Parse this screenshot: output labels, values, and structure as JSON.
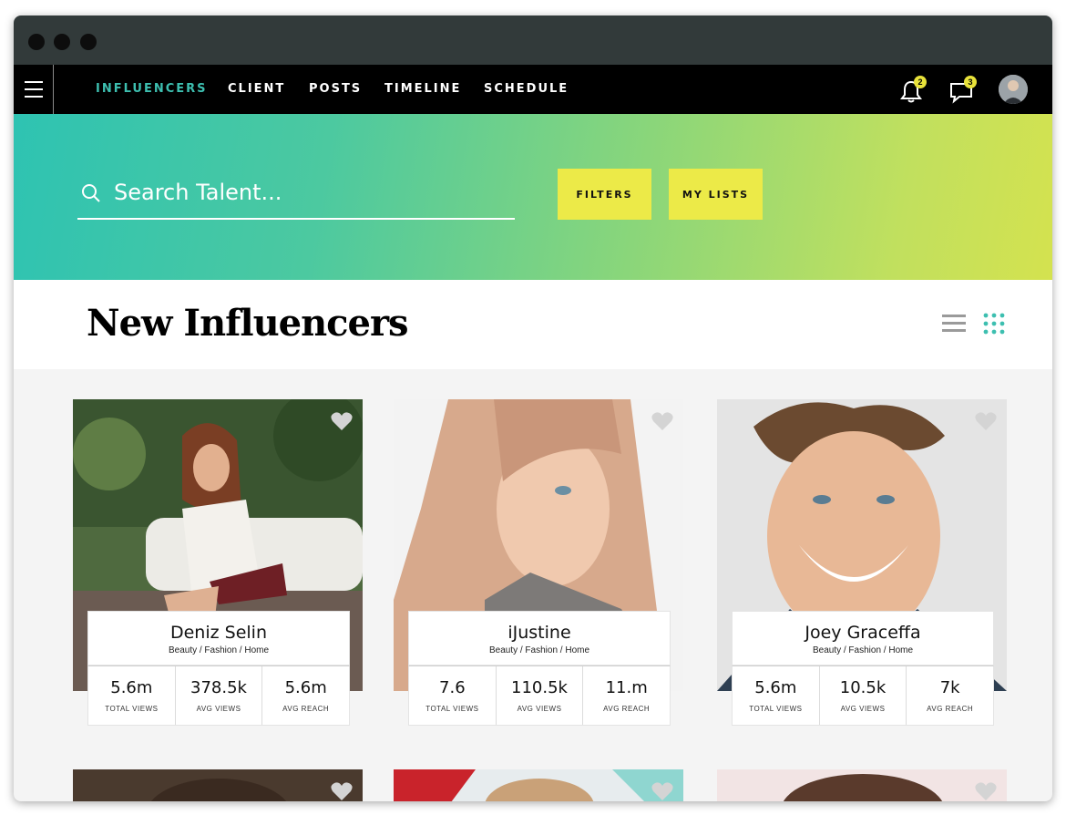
{
  "nav": {
    "items": [
      {
        "label": "INFLUENCERS",
        "active": true
      },
      {
        "label": "CLIENT",
        "active": false
      },
      {
        "label": "POSTS",
        "active": false
      },
      {
        "label": "TIMELINE",
        "active": false
      },
      {
        "label": "SCHEDULE",
        "active": false
      }
    ],
    "notifications_count": "2",
    "messages_count": "3",
    "icons": [
      "menu-icon",
      "bell-icon",
      "chat-icon",
      "avatar"
    ]
  },
  "search": {
    "placeholder": "Search Talent..."
  },
  "buttons": {
    "filters": "FILTERS",
    "my_lists": "MY LISTS"
  },
  "page": {
    "title": "New Influencers"
  },
  "colors": {
    "accent": "#3dbfb0",
    "button_yellow": "#ecea48",
    "nav_bg": "#000000"
  },
  "influencers": [
    {
      "name": "Deniz Selin",
      "categories": "Beauty / Fashion / Home",
      "stats": [
        {
          "value": "5.6m",
          "label": "TOTAL VIEWS"
        },
        {
          "value": "378.5k",
          "label": "AVG VIEWS"
        },
        {
          "value": "5.6m",
          "label": "AVG REACH"
        }
      ]
    },
    {
      "name": "iJustine",
      "categories": "Beauty / Fashion / Home",
      "stats": [
        {
          "value": "7.6",
          "label": "TOTAL VIEWS"
        },
        {
          "value": "110.5k",
          "label": "AVG VIEWS"
        },
        {
          "value": "11.m",
          "label": "AVG REACH"
        }
      ]
    },
    {
      "name": "Joey Graceffa",
      "categories": "Beauty / Fashion / Home",
      "stats": [
        {
          "value": "5.6m",
          "label": "TOTAL VIEWS"
        },
        {
          "value": "10.5k",
          "label": "AVG VIEWS"
        },
        {
          "value": "7k",
          "label": "AVG REACH"
        }
      ]
    }
  ]
}
